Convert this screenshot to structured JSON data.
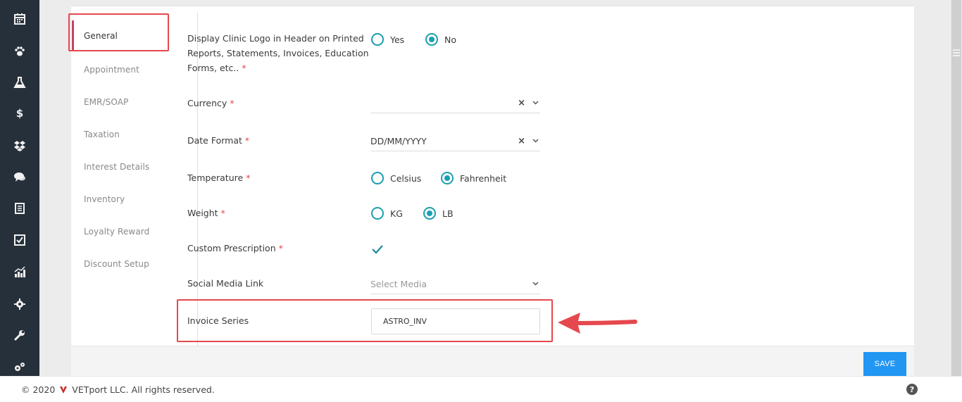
{
  "sidebar": {
    "icons": [
      "calendar-icon",
      "paw-icon",
      "flask-icon",
      "dollar-icon",
      "dropbox-icon",
      "chat-icon",
      "receipt-icon",
      "checkbox-icon",
      "chart-icon",
      "gear-icon",
      "wrench-icon",
      "gears-icon"
    ],
    "dollar_glyph": "$"
  },
  "tabs": [
    {
      "label": "General",
      "active": true
    },
    {
      "label": "Appointment"
    },
    {
      "label": "EMR/SOAP"
    },
    {
      "label": "Taxation"
    },
    {
      "label": "Interest Details"
    },
    {
      "label": "Inventory"
    },
    {
      "label": "Loyalty Reward"
    },
    {
      "label": "Discount Setup"
    }
  ],
  "form": {
    "logo": {
      "label_line1": "Display Clinic Logo in Header on Printed",
      "label_line2": "Reports, Statements, Invoices, Education",
      "label_line3": "Forms, etc..",
      "required": "*",
      "option_yes": "Yes",
      "option_no": "No",
      "selected": "No"
    },
    "currency": {
      "label": "Currency",
      "required": "*",
      "value": ""
    },
    "date_format": {
      "label": "Date Format",
      "required": "*",
      "value": "DD/MM/YYYY"
    },
    "temperature": {
      "label": "Temperature",
      "required": "*",
      "option_1": "Celsius",
      "option_2": "Fahrenheit",
      "selected": "Fahrenheit"
    },
    "weight": {
      "label": "Weight",
      "required": "*",
      "option_1": "KG",
      "option_2": "LB",
      "selected": "LB"
    },
    "custom_prescription": {
      "label": "Custom Prescription",
      "required": "*",
      "checked": true
    },
    "social_media": {
      "label": "Social Media Link",
      "placeholder": "Select Media"
    },
    "invoice_series": {
      "label": "Invoice Series",
      "value": "ASTRO_INV"
    },
    "clear_glyph": "×",
    "chevron_glyph": "⌄"
  },
  "save_label": "SAVE",
  "footer": {
    "copyright": "© 2020",
    "company": "VETport LLC. All rights reserved.",
    "help_glyph": "?"
  },
  "colors": {
    "accent": "#1a9fb0",
    "save": "#2196f3",
    "highlight": "#e5484d",
    "sidebar": "#26303a"
  }
}
